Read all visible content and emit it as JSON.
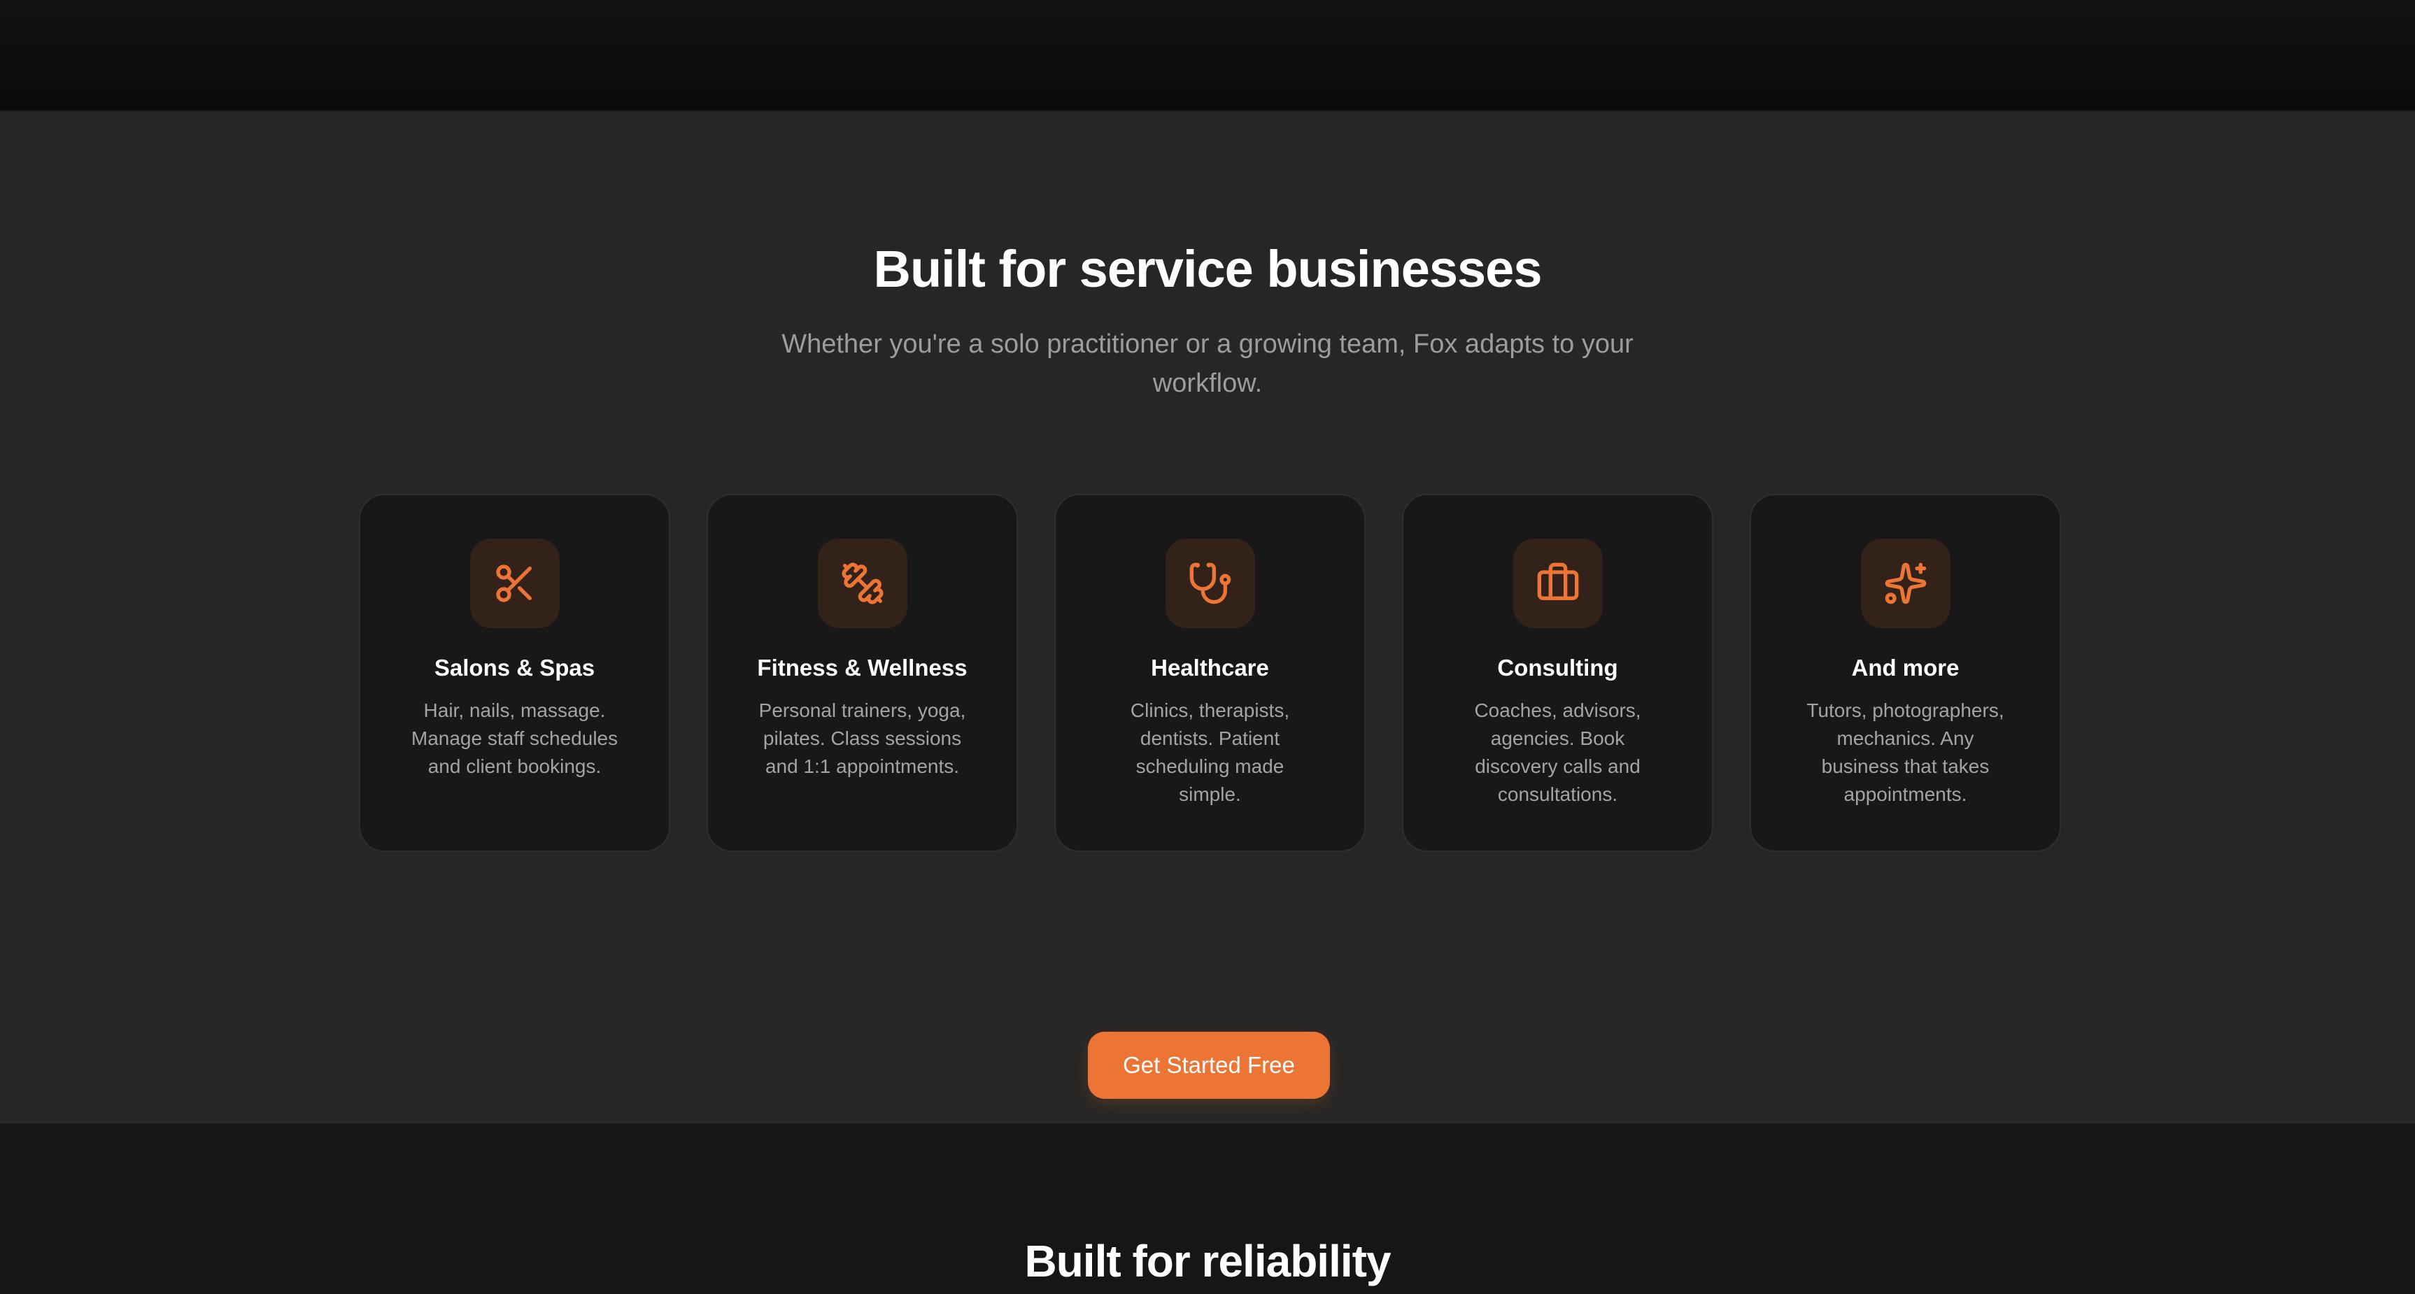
{
  "section": {
    "heading": "Built for service businesses",
    "subheading": "Whether you're a solo practitioner or a growing team, Fox adapts to your workflow."
  },
  "cards": [
    {
      "icon": "scissors-icon",
      "title": "Salons & Spas",
      "description": "Hair, nails, massage. Manage staff schedules and client bookings."
    },
    {
      "icon": "dumbbell-icon",
      "title": "Fitness & Wellness",
      "description": "Personal trainers, yoga, pilates. Class sessions and 1:1 appointments."
    },
    {
      "icon": "stethoscope-icon",
      "title": "Healthcare",
      "description": "Clinics, therapists, dentists. Patient scheduling made simple."
    },
    {
      "icon": "briefcase-icon",
      "title": "Consulting",
      "description": "Coaches, advisors, agencies. Book discovery calls and consultations."
    },
    {
      "icon": "sparkles-icon",
      "title": "And more",
      "description": "Tutors, photographers, mechanics. Any business that takes appointments."
    }
  ],
  "cta": {
    "label": "Get Started Free"
  },
  "next_section": {
    "heading": "Built for reliability"
  },
  "colors": {
    "accent": "#ec7536",
    "page_background": "#262626",
    "card_background": "#181818",
    "icon_tile": "#33221a"
  }
}
